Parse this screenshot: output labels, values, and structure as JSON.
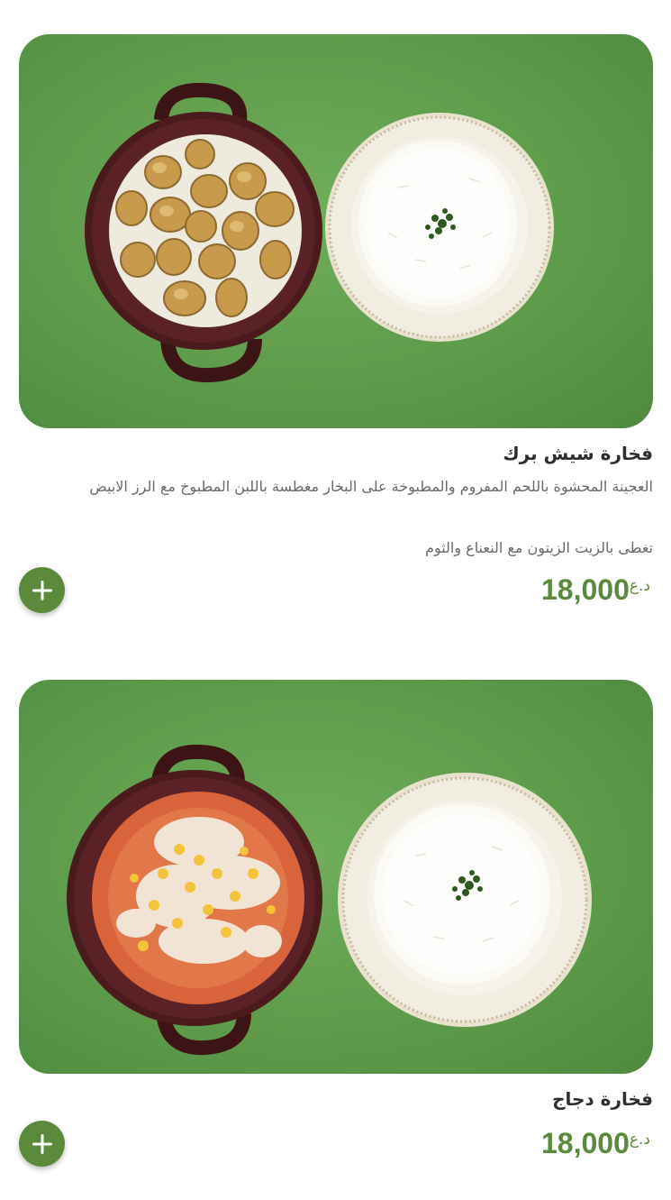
{
  "colors": {
    "accent": "#5b8a3c",
    "photo_background": "#5f9d4c",
    "pot": "#4a1a1c",
    "plate": "#f1ece0"
  },
  "items": [
    {
      "title": "فخارة شيش برك",
      "description": "العجينة المحشوة باللحم المفروم والمطبوخة على البخار مغطسة باللبن المطبوخ مع الرز الابيض",
      "description_2": "تغطى بالزيت الزيتون مع النعناع والثوم",
      "price": "18,000",
      "currency": "د.ع",
      "add_icon": "plus-icon"
    },
    {
      "title": "فخارة دجاج",
      "price": "18,000",
      "currency": "د.ع",
      "add_icon": "plus-icon"
    }
  ]
}
